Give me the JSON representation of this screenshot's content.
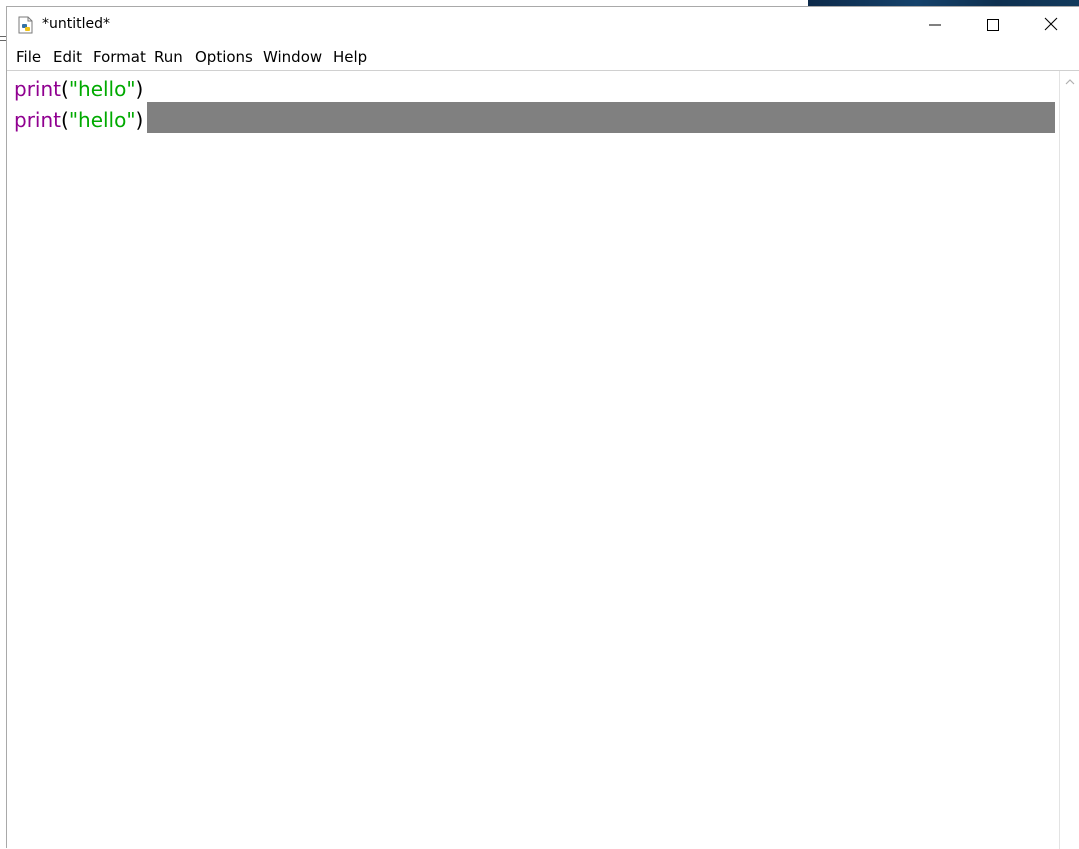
{
  "window": {
    "title": "*untitled*",
    "icon": "python-idle-icon"
  },
  "titlebar_buttons": {
    "minimize": "minimize-icon",
    "maximize": "maximize-icon",
    "close": "close-icon"
  },
  "menu": {
    "items": [
      "File",
      "Edit",
      "Format",
      "Run",
      "Options",
      "Window",
      "Help"
    ]
  },
  "editor": {
    "lines": [
      {
        "keyword": "print",
        "open": "(",
        "string": "\"hello\"",
        "close": ")"
      },
      {
        "keyword": "print",
        "open": "(",
        "string": "\"hello\"",
        "close": ")"
      }
    ],
    "colors": {
      "keyword": "#900090",
      "string": "#00aa00",
      "selection": "#808080"
    }
  },
  "scrollbar": {
    "up_arrow": "chevron-up-icon"
  }
}
